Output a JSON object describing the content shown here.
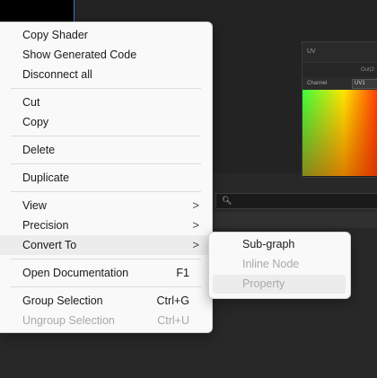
{
  "background": {
    "node": {
      "title": "UV",
      "output_label": "Out(2",
      "channel_label": "Channel",
      "channel_value": "UV1"
    },
    "search_icon": "search-icon"
  },
  "context_menu": {
    "copy_shader": "Copy Shader",
    "show_generated_code": "Show Generated Code",
    "disconnect_all": "Disconnect all",
    "cut": "Cut",
    "copy": "Copy",
    "delete": "Delete",
    "duplicate": "Duplicate",
    "view": "View",
    "precision": "Precision",
    "convert_to": "Convert To",
    "open_documentation": "Open Documentation",
    "open_documentation_shortcut": "F1",
    "group_selection": "Group Selection",
    "group_selection_shortcut": "Ctrl+G",
    "ungroup_selection": "Ungroup Selection",
    "ungroup_selection_shortcut": "Ctrl+U",
    "arrow": ">"
  },
  "submenu": {
    "sub_graph": "Sub-graph",
    "inline_node": "Inline Node",
    "property": "Property"
  }
}
